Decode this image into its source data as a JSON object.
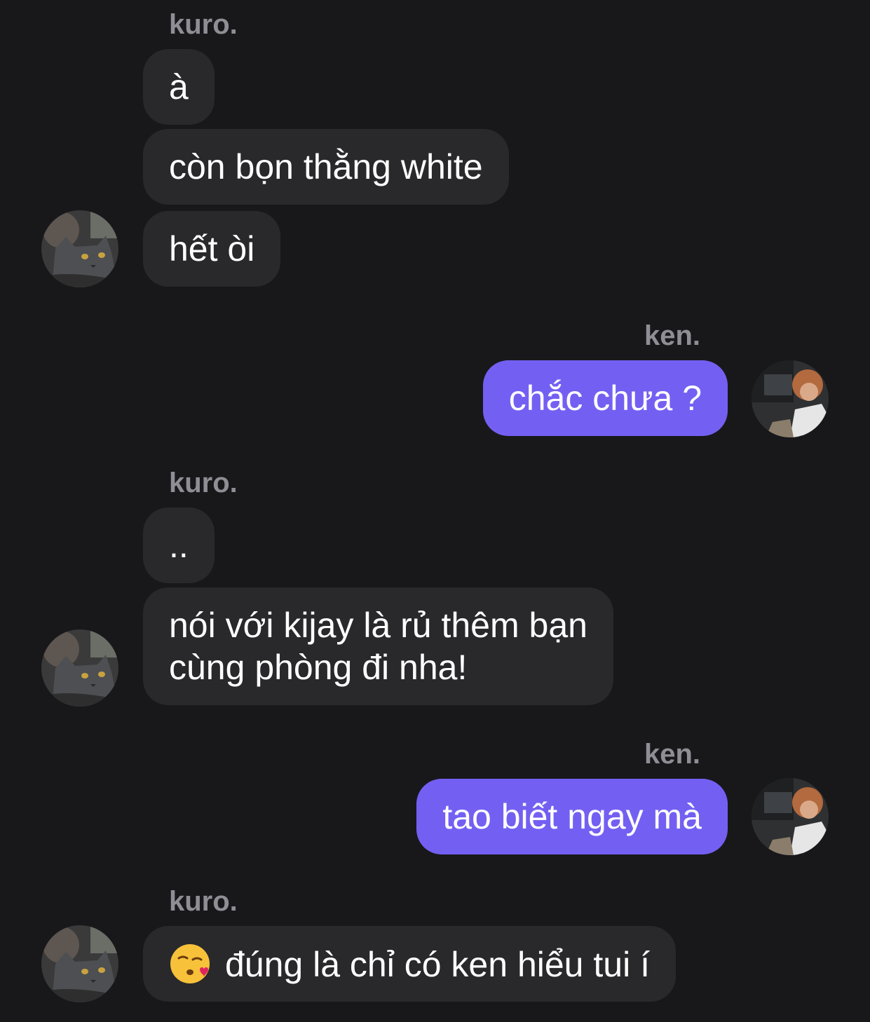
{
  "chat": {
    "groups": [
      {
        "sender": "kuro.",
        "direction": "incoming",
        "messages": [
          "à",
          "còn bọn thằng white",
          "hết òi"
        ]
      },
      {
        "sender": "ken.",
        "direction": "outgoing",
        "messages": [
          "chắc chưa ?"
        ]
      },
      {
        "sender": "kuro.",
        "direction": "incoming",
        "messages": [
          "..",
          "nói với kijay là rủ thêm bạn",
          "cùng phòng đi nha!"
        ]
      },
      {
        "sender": "ken.",
        "direction": "outgoing",
        "messages": [
          "tao biết ngay mà"
        ]
      },
      {
        "sender": "kuro.",
        "direction": "incoming",
        "messages": [
          "đúng là chỉ có ken hiểu tui í"
        ],
        "emoji": "face-blowing-a-kiss"
      }
    ]
  },
  "colors": {
    "background": "#18181b",
    "incoming_bubble": "#29292c",
    "outgoing_bubble": "#7360f2",
    "sender_name": "#8e8e94",
    "text": "#ffffff"
  }
}
